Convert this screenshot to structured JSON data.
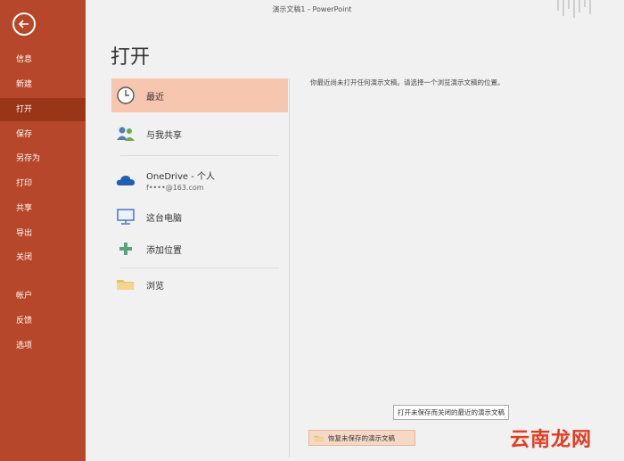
{
  "window": {
    "title": "演示文稿1  -  PowerPoint"
  },
  "sidebar": {
    "items": [
      {
        "label": "信息"
      },
      {
        "label": "新建"
      },
      {
        "label": "打开",
        "active": true
      },
      {
        "label": "保存"
      },
      {
        "label": "另存为"
      },
      {
        "label": "打印"
      },
      {
        "label": "共享"
      },
      {
        "label": "导出"
      },
      {
        "label": "关闭"
      },
      {
        "label": "帐户"
      },
      {
        "label": "反馈"
      },
      {
        "label": "选项"
      }
    ]
  },
  "main": {
    "heading": "打开",
    "locations": {
      "recent": "最近",
      "shared": "与我共享",
      "onedrive": "OneDrive - 个人",
      "onedrive_account": "f••••@163.com",
      "this_pc": "这台电脑",
      "add_place": "添加位置",
      "browse": "浏览"
    },
    "message": "你最近尚未打开任何演示文稿。请选择一个浏览演示文稿的位置。",
    "recover_button": "恢复未保存的演示文稿",
    "tooltip": "打开未保存而关闭的最近的演示文稿"
  },
  "watermark": "云南龙网",
  "colors": {
    "sidebar": "#b7472a",
    "accent_selected": "#f6c7ae"
  }
}
